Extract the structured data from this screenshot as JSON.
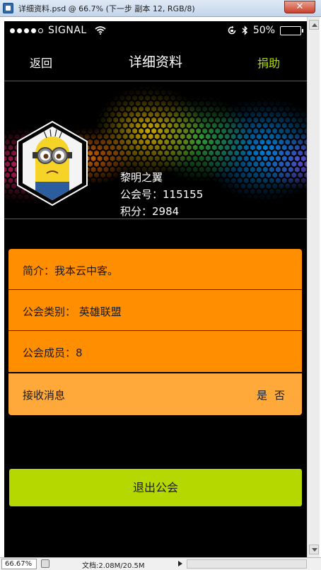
{
  "window": {
    "title": "详细资料.psd @ 66.7% (下一步 副本 12, RGB/8)",
    "close_label": "✕",
    "zoom": "66.67%",
    "doc_info": "文档:2.08M/20.5M"
  },
  "statusbar": {
    "carrier": "SIGNAL",
    "signal_dots_filled": 4,
    "battery_text": "50%",
    "battery_level": 0.5
  },
  "navbar": {
    "back_label": "返回",
    "title": "详细资料",
    "donate_label": "捐助"
  },
  "profile": {
    "name": "黎明之翼",
    "guild_id": "公会号：115155",
    "points": "积分：2984"
  },
  "details": {
    "intro": "简介：我本云中客。",
    "category": "公会类别： 英雄联盟",
    "members": "公会成员：8",
    "receive_label": "接收消息",
    "yes_label": "是",
    "no_label": "否"
  },
  "actions": {
    "exit_label": "退出公会"
  },
  "colors": {
    "orange": "#ff8f00",
    "orange_light": "#ffa93a",
    "lime": "#b5d800"
  }
}
